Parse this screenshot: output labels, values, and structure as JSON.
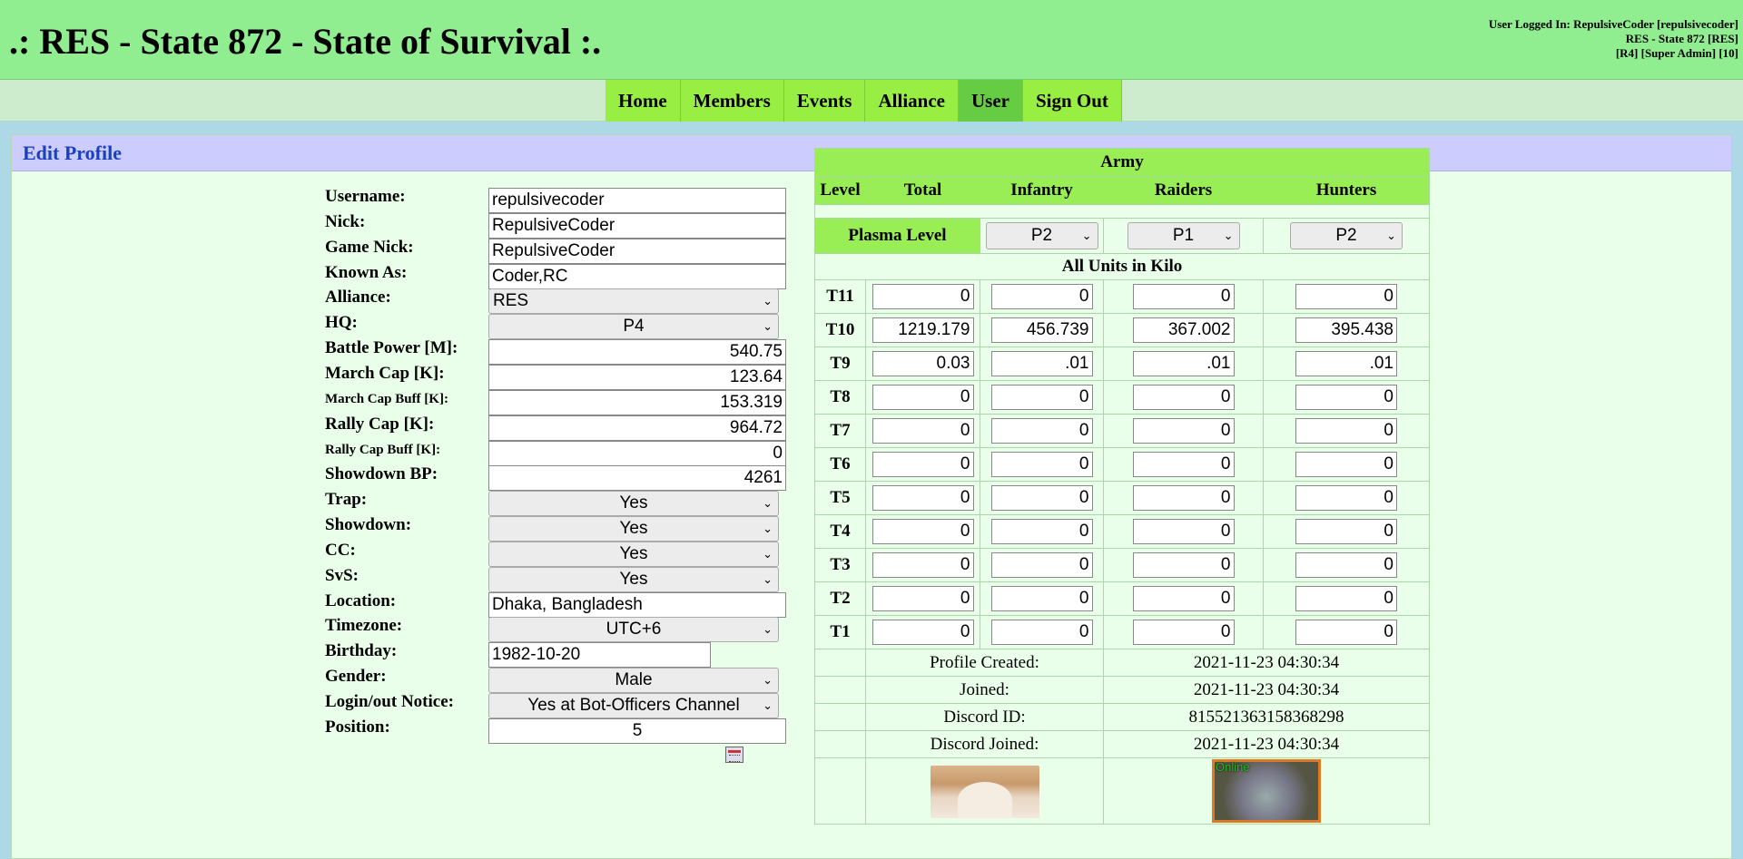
{
  "header": {
    "site_title": ".: RES - State 872 - State of Survival :.",
    "user_line1": "User Logged In: RepulsiveCoder [repulsivecoder]",
    "user_line2": "RES - State 872 [RES]",
    "user_line3": "[R4] [Super Admin] [10]"
  },
  "nav": {
    "items": [
      "Home",
      "Members",
      "Events",
      "Alliance",
      "User",
      "Sign Out"
    ],
    "active": "User"
  },
  "section": {
    "title": "Edit Profile"
  },
  "profile": {
    "fields": [
      {
        "label": "Username:",
        "value": "repulsivecoder",
        "type": "text"
      },
      {
        "label": "Nick:",
        "value": "RepulsiveCoder",
        "type": "text"
      },
      {
        "label": "Game Nick:",
        "value": "RepulsiveCoder",
        "type": "text"
      },
      {
        "label": "Known As:",
        "value": "Coder,RC",
        "type": "text"
      },
      {
        "label": "Alliance:",
        "value": "RES",
        "type": "select-left"
      },
      {
        "label": "HQ:",
        "value": "P4",
        "type": "select"
      },
      {
        "label": "Battle Power [M]:",
        "value": "540.75",
        "type": "number"
      },
      {
        "label": "March Cap [K]:",
        "value": "123.64",
        "type": "number"
      },
      {
        "label": "March Cap Buff [K]:",
        "value": "153.319",
        "type": "number"
      },
      {
        "label": "Rally Cap [K]:",
        "value": "964.72",
        "type": "number"
      },
      {
        "label": "Rally Cap Buff [K]:",
        "value": "0",
        "type": "number"
      },
      {
        "label": "Showdown BP:",
        "value": "4261",
        "type": "number"
      },
      {
        "label": "Trap:",
        "value": "Yes",
        "type": "select"
      },
      {
        "label": "Showdown:",
        "value": "Yes",
        "type": "select"
      },
      {
        "label": "CC:",
        "value": "Yes",
        "type": "select"
      },
      {
        "label": "SvS:",
        "value": "Yes",
        "type": "select"
      },
      {
        "label": "Location:",
        "value": "Dhaka, Bangladesh",
        "type": "text"
      },
      {
        "label": "Timezone:",
        "value": "UTC+6",
        "type": "select"
      },
      {
        "label": "Birthday:",
        "value": "1982-10-20",
        "type": "date"
      },
      {
        "label": "Gender:",
        "value": "Male",
        "type": "select"
      },
      {
        "label": "Login/out Notice:",
        "value": "Yes at Bot-Officers Channel",
        "type": "select"
      },
      {
        "label": "Position:",
        "value": "5",
        "type": "text-center"
      }
    ]
  },
  "army": {
    "title": "Army",
    "columns": [
      "Level",
      "Total",
      "Infantry",
      "Raiders",
      "Hunters"
    ],
    "plasma_label": "Plasma Level",
    "plasma_values": [
      "P2",
      "P1",
      "P2"
    ],
    "units_label": "All Units in Kilo",
    "rows": [
      {
        "tier": "T11",
        "values": [
          "0",
          "0",
          "0",
          "0"
        ]
      },
      {
        "tier": "T10",
        "values": [
          "1219.179",
          "456.739",
          "367.002",
          "395.438"
        ]
      },
      {
        "tier": "T9",
        "values": [
          "0.03",
          ".01",
          ".01",
          ".01"
        ]
      },
      {
        "tier": "T8",
        "values": [
          "0",
          "0",
          "0",
          "0"
        ]
      },
      {
        "tier": "T7",
        "values": [
          "0",
          "0",
          "0",
          "0"
        ]
      },
      {
        "tier": "T6",
        "values": [
          "0",
          "0",
          "0",
          "0"
        ]
      },
      {
        "tier": "T5",
        "values": [
          "0",
          "0",
          "0",
          "0"
        ]
      },
      {
        "tier": "T4",
        "values": [
          "0",
          "0",
          "0",
          "0"
        ]
      },
      {
        "tier": "T3",
        "values": [
          "0",
          "0",
          "0",
          "0"
        ]
      },
      {
        "tier": "T2",
        "values": [
          "0",
          "0",
          "0",
          "0"
        ]
      },
      {
        "tier": "T1",
        "values": [
          "0",
          "0",
          "0",
          "0"
        ]
      }
    ],
    "info": [
      {
        "label": "Profile Created:",
        "value": "2021-11-23 04:30:34"
      },
      {
        "label": "Joined:",
        "value": "2021-11-23 04:30:34"
      },
      {
        "label": "Discord ID:",
        "value": "815521363158368298"
      },
      {
        "label": "Discord Joined:",
        "value": "2021-11-23 04:30:34"
      }
    ],
    "online_badge": "Online"
  },
  "icons": {
    "select_arrow": "chevron-down-icon",
    "calendar": "calendar-icon"
  },
  "colors": {
    "header_bg": "#90ee90",
    "nav_bg": "#99ee44",
    "nav_active_bg": "#66cc44",
    "content_bg": "#eaffea",
    "section_header_bg": "#ccccff",
    "section_title": "#1a3fbf",
    "page_bg": "#add8e6"
  }
}
